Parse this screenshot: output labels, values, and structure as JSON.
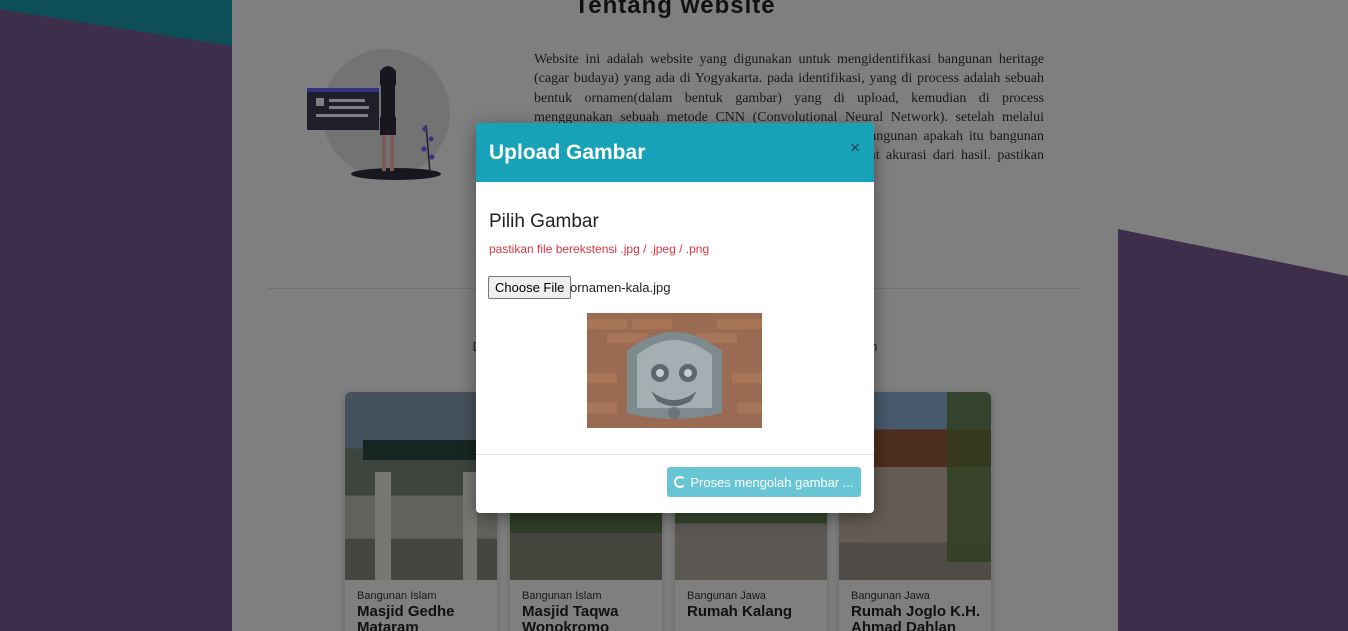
{
  "about": {
    "title": "Tentang website",
    "text": "Website ini adalah website yang digunakan untuk mengidentifikasi bangunan heritage (cagar budaya) yang ada di Yogyakarta. pada identifikasi, yang di process adalah sebuah bentuk ornamen(dalam bentuk gambar) yang di upload, kemudian di process menggunakan sebuah metode CNN (Convolutional Neural Network). setelah melalui proses tersebut, akan muncul sebuah hasil berupa jenis bangunan apakah itu bangunan Islam, Jawa ataupun Tionghoa, serta dapat melihat tingkat akurasi dari hasil. pastikan gambar yang di upload jelas atau tidak blur sehingga dapat"
  },
  "data_section": {
    "text": "Data bangunan yang dapat di identifikasi, dikelompokkan berdasarkan"
  },
  "cards": [
    {
      "category": "Bangunan Islam",
      "title": "Masjid Gedhe Mataram"
    },
    {
      "category": "Bangunan Islam",
      "title": "Masjid Taqwa Wonokromo"
    },
    {
      "category": "Bangunan Jawa",
      "title": "Rumah Kalang"
    },
    {
      "category": "Bangunan Jawa",
      "title": "Rumah Joglo K.H. Ahmad Dahlan"
    }
  ],
  "modal": {
    "title": "Upload Gambar",
    "close_label": "×",
    "pick_title": "Pilih Gambar",
    "hint": "pastikan file berekstensi .jpg / .jpeg / .png",
    "choose_file_label": "Choose File",
    "file_name": "ornamen-kala.jpg",
    "process_label": "Proses mengolah gambar ..."
  },
  "colors": {
    "accent": "#17a2b8",
    "background_purple": "#7b5f98",
    "hint_red": "#dc3545",
    "button_disabled": "#67c5d4"
  },
  "icons": {
    "close": "close-icon",
    "spinner": "spinner-icon"
  }
}
